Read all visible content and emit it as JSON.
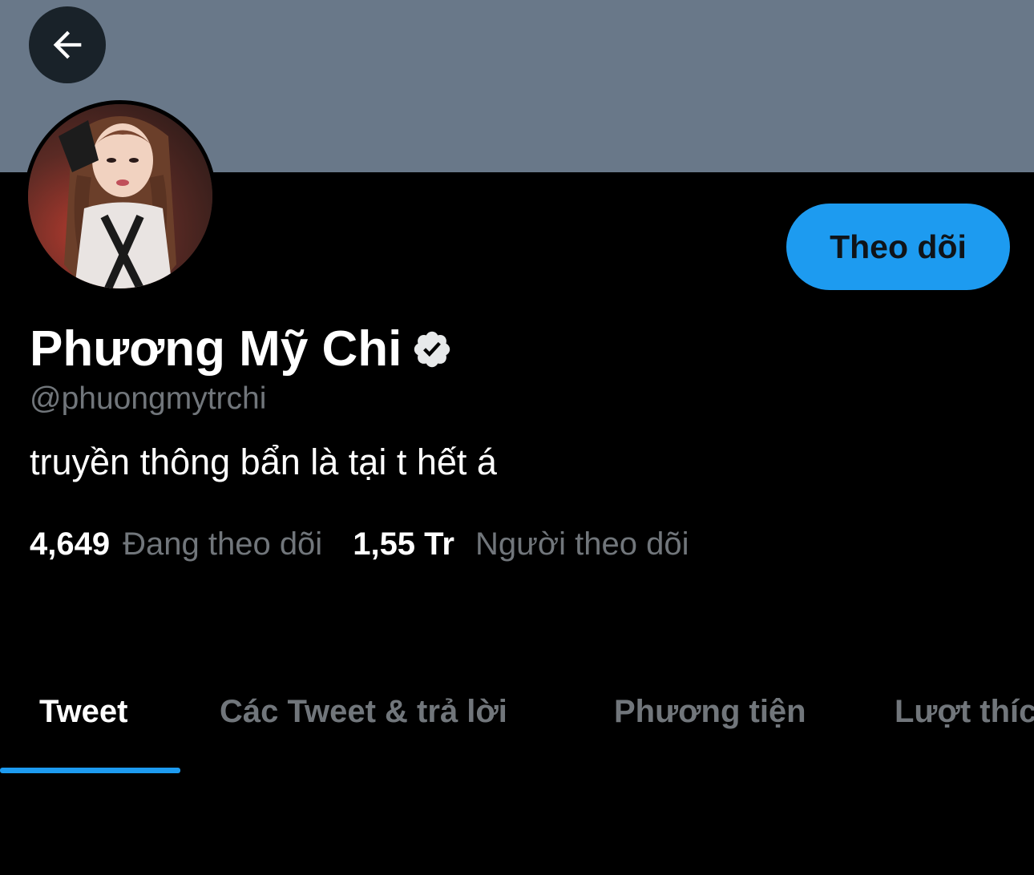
{
  "header": {
    "back_icon": "arrow-left-icon",
    "banner_color": "#697889"
  },
  "profile": {
    "display_name": "Phương Mỹ Chi",
    "verified_icon": "verified-badge-icon",
    "handle": "@phuongmytrchi",
    "bio": "truyền thông bẩn là tại t hết á",
    "follow_label": "Theo dõi"
  },
  "stats": {
    "following_count": "4,649",
    "following_label": "Đang theo dõi",
    "followers_count": "1,55 Tr",
    "followers_label": "Người theo dõi"
  },
  "tabs": [
    {
      "label": "Tweet",
      "active": true
    },
    {
      "label": "Các Tweet & trả lời",
      "active": false
    },
    {
      "label": "Phương tiện",
      "active": false
    },
    {
      "label": "Lượt thích",
      "active": false
    }
  ],
  "colors": {
    "accent": "#1d9bf0",
    "background": "#000000",
    "secondary_text": "#71767b"
  }
}
